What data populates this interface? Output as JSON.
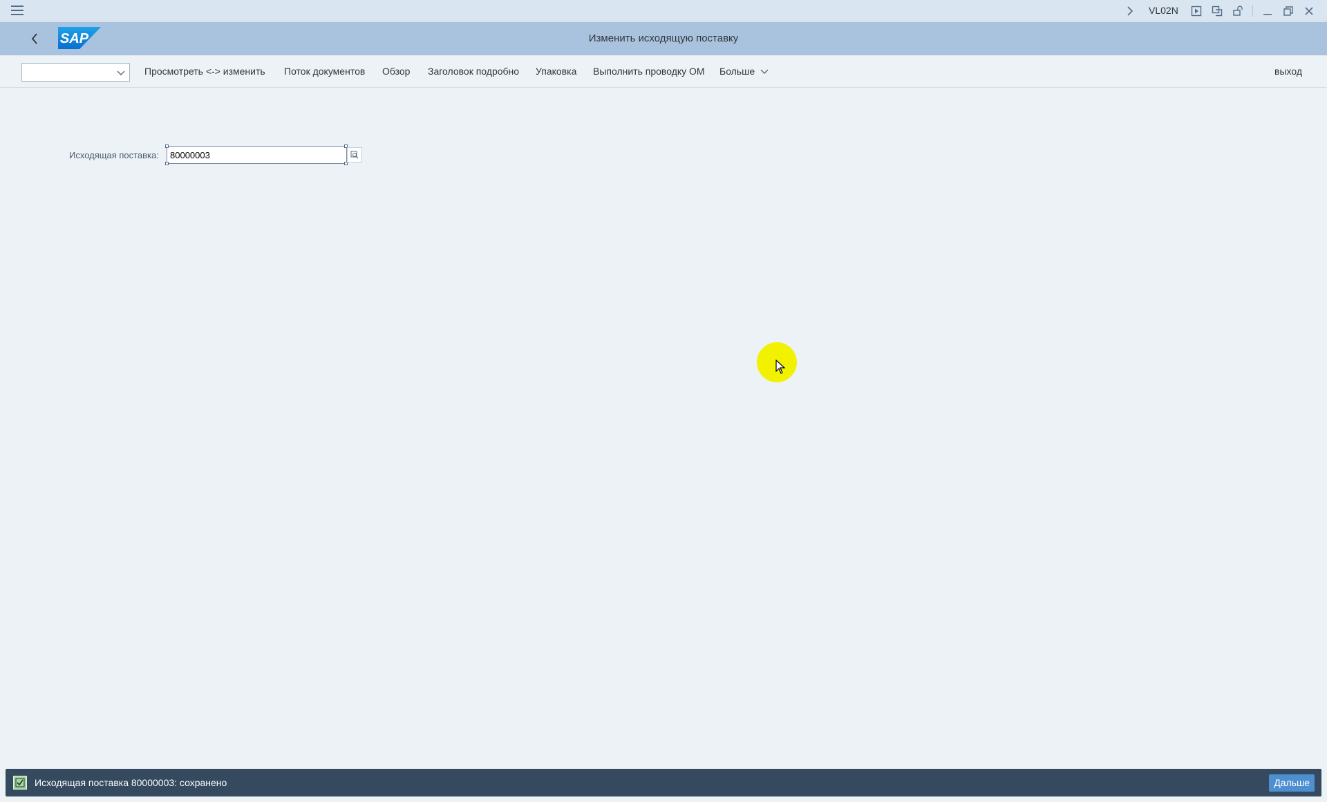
{
  "window": {
    "tcode": "VL02N",
    "icons": [
      "menu-icon",
      "chevron-right-icon",
      "execute-icon",
      "customize-icon",
      "security-icon",
      "minimize-icon",
      "restore-icon",
      "close-icon"
    ]
  },
  "shell": {
    "title": "Изменить исходящую поставку",
    "logo_text": "SAP",
    "brand_color": "#0a6ed1"
  },
  "toolbar": {
    "select_value": "",
    "buttons": [
      "Просмотреть <-> изменить",
      "Поток документов",
      "Обзор",
      "Заголовок подробно",
      "Упаковка",
      "Выполнить проводку ОМ",
      "Больше"
    ],
    "exit_label": "выход"
  },
  "form": {
    "delivery_label": "Исходящая поставка:",
    "delivery_value": "80000003"
  },
  "status": {
    "type": "success",
    "message": "Исходящая поставка 80000003: сохранено",
    "button_label": "Дальше"
  }
}
